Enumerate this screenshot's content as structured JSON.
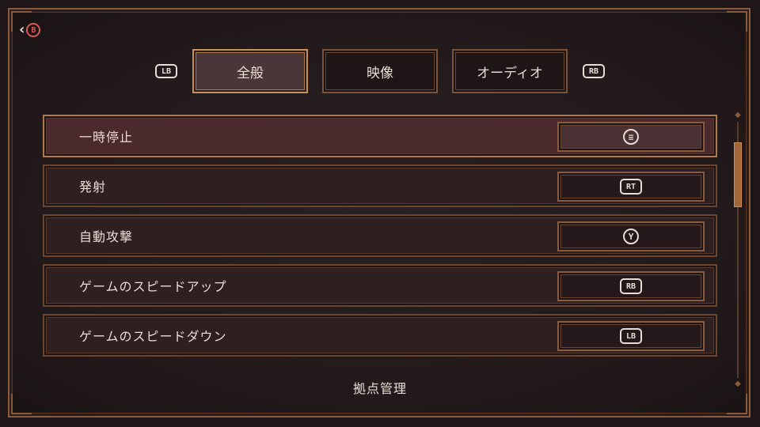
{
  "nav": {
    "back_button_glyph": "B"
  },
  "tabs": {
    "prev_glyph": "LB",
    "next_glyph": "RB",
    "items": [
      {
        "label": "全般",
        "active": true
      },
      {
        "label": "映像",
        "active": false
      },
      {
        "label": "オーディオ",
        "active": false
      }
    ]
  },
  "bindings": [
    {
      "label": "一時停止",
      "button_icon": "menu-button-icon",
      "button_glyph": "≡",
      "selected": true
    },
    {
      "label": "発射",
      "button_icon": "rt-trigger-icon",
      "button_glyph": "RT",
      "selected": false
    },
    {
      "label": "自動攻撃",
      "button_icon": "y-button-icon",
      "button_glyph": "Y",
      "selected": false
    },
    {
      "label": "ゲームのスピードアップ",
      "button_icon": "rb-bumper-icon",
      "button_glyph": "RB",
      "selected": false
    },
    {
      "label": "ゲームのスピードダウン",
      "button_icon": "lb-bumper-icon",
      "button_glyph": "LB",
      "selected": false
    }
  ],
  "next_section": {
    "label": "拠点管理"
  },
  "colors": {
    "accent": "#b07a4a",
    "back_button": "#d45a5a",
    "selected_row": "#4a2a2c"
  }
}
